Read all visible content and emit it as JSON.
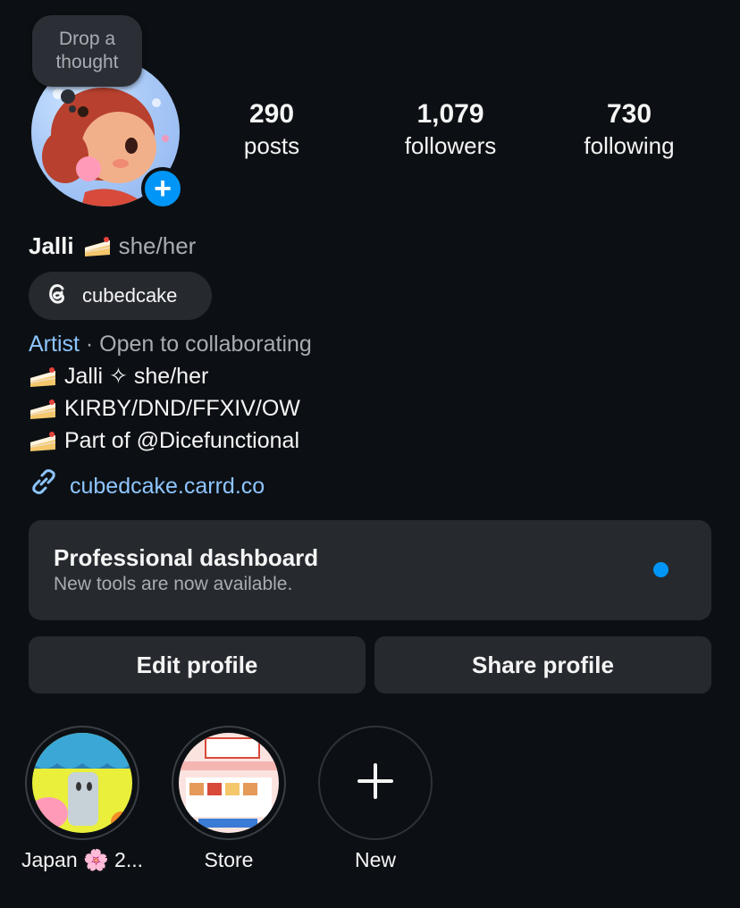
{
  "note": {
    "text": "Drop a thought"
  },
  "stats": {
    "posts": {
      "count": "290",
      "label": "posts"
    },
    "followers": {
      "count": "1,079",
      "label": "followers"
    },
    "following": {
      "count": "730",
      "label": "following"
    }
  },
  "profile": {
    "name": "Jalli",
    "pronouns": "she/her",
    "threads_handle": "cubedcake",
    "category": "Artist",
    "category_suffix": " · Open to collaborating",
    "bio_lines": [
      "Jalli ✧ she/her",
      "KIRBY/DND/FFXIV/OW",
      "Part of @Dicefunctional"
    ],
    "link": "cubedcake.carrd.co"
  },
  "dashboard": {
    "title": "Professional dashboard",
    "subtitle": "New tools are now available."
  },
  "buttons": {
    "edit": "Edit profile",
    "share": "Share profile"
  },
  "highlights": [
    {
      "label": "Japan 🌸 2..."
    },
    {
      "label": "Store"
    },
    {
      "label": "New"
    }
  ],
  "colors": {
    "background": "#0c1014",
    "accent_blue": "#0095f6",
    "link_blue": "#8ec5ff",
    "surface": "#262a2f",
    "muted_text": "#a8adb3"
  }
}
